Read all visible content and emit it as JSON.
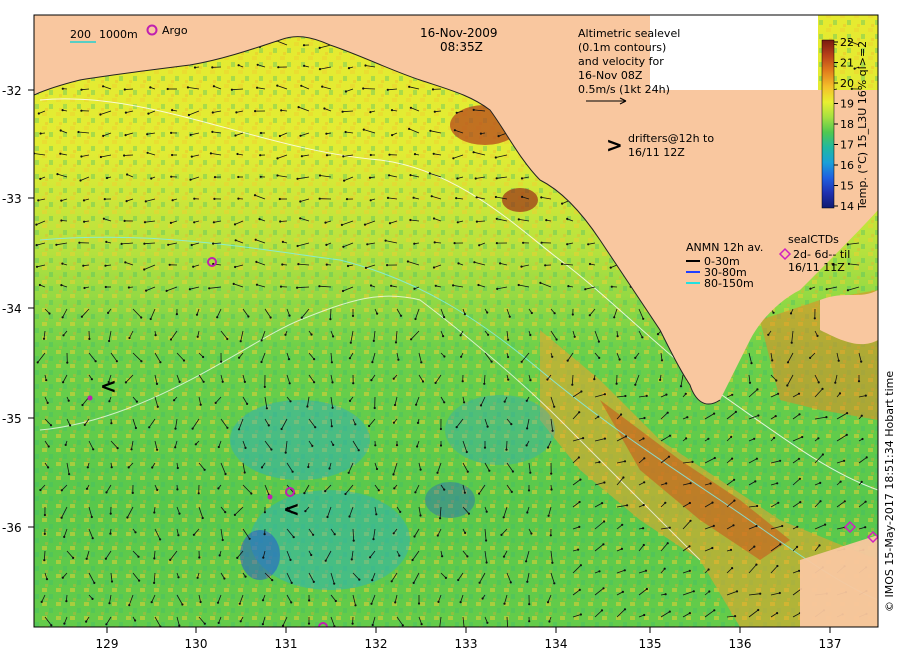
{
  "header": {
    "date": "16-Nov-2009",
    "time": "08:35Z"
  },
  "legend": {
    "depth_200": "200",
    "depth_1000": "1000m",
    "argo": "Argo",
    "altimetric_lines": [
      "Altimetric sealevel",
      "(0.1m contours)",
      "and velocity for",
      "16-Nov 08Z",
      "0.5m/s (1kt 24h)"
    ],
    "drifters_symbol": ">",
    "drifters_lines": [
      "drifters@12h to",
      "16/11 12Z"
    ],
    "anmn_title": "ANMN 12h av.",
    "anmn_rows": [
      {
        "label": "0-30m",
        "color": "#000000"
      },
      {
        "label": "30-80m",
        "color": "#1f3fff"
      },
      {
        "label": "80-150m",
        "color": "#22e0e0"
      }
    ],
    "sealctd_title": "sealCTDs",
    "sealctd_lines": [
      "2d- 6d-- til",
      "16/11 11Z"
    ]
  },
  "colorbar": {
    "ticks": [
      "22",
      "21",
      "20",
      "19",
      "18",
      "17",
      "16",
      "15",
      "14"
    ],
    "label": "Temp. (°C) 15_L3U 16% ql>=2",
    "colors": [
      "#7a1a10",
      "#b8401a",
      "#e07a1c",
      "#f5c02a",
      "#e8f030",
      "#a6e040",
      "#50c850",
      "#20b8a0",
      "#1aa0d8",
      "#2060e0",
      "#2030b0",
      "#101a70"
    ]
  },
  "axes": {
    "lon_ticks": [
      "129",
      "130",
      "131",
      "132",
      "133",
      "134",
      "135",
      "136",
      "137"
    ],
    "lat_ticks": [
      "-32",
      "-33",
      "-34",
      "-35",
      "-36"
    ]
  },
  "credit": "© IMOS 15-May-2017 18:51:34 Hobart time",
  "colors": {
    "land": "#f9c79f",
    "argo": "#d020c0",
    "drifter": "#ff00ff"
  }
}
